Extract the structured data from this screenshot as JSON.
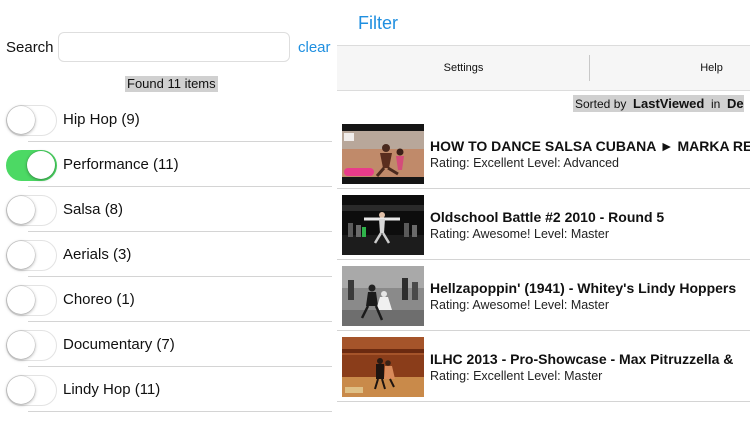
{
  "search": {
    "label": "Search",
    "value": "",
    "placeholder": "",
    "clear_label": "clear"
  },
  "found_label": "Found 11 items",
  "categories": [
    {
      "label": "Hip Hop  (9)",
      "on": false
    },
    {
      "label": "Performance  (11)",
      "on": true
    },
    {
      "label": "Salsa  (8)",
      "on": false
    },
    {
      "label": "Aerials  (3)",
      "on": false
    },
    {
      "label": "Choreo  (1)",
      "on": false
    },
    {
      "label": "Documentary  (7)",
      "on": false
    },
    {
      "label": "Lindy Hop  (11)",
      "on": false
    }
  ],
  "header": {
    "title": "Filter"
  },
  "toolbar": {
    "settings_label": "Settings",
    "help_label": "Help"
  },
  "sort": {
    "prefix": "Sorted by",
    "field": "LastViewed",
    "in_label": "in",
    "order": "De"
  },
  "videos": [
    {
      "title": "HOW TO DANCE SALSA CUBANA ► MARKA RE",
      "meta": "Rating: Excellent   Level: Advanced"
    },
    {
      "title": "Oldschool Battle #2 2010 - Round 5",
      "meta": "Rating: Awesome!   Level: Master"
    },
    {
      "title": "Hellzapoppin' (1941) - Whitey's Lindy Hoppers",
      "meta": "Rating: Awesome!   Level: Master"
    },
    {
      "title": "ILHC 2013 - Pro-Showcase - Max Pitruzzella &",
      "meta": "Rating: Excellent   Level: Master"
    }
  ],
  "colors": {
    "accent": "#1f8fe0",
    "toggle_on": "#4cd964",
    "highlight": "#d0d0d0"
  }
}
